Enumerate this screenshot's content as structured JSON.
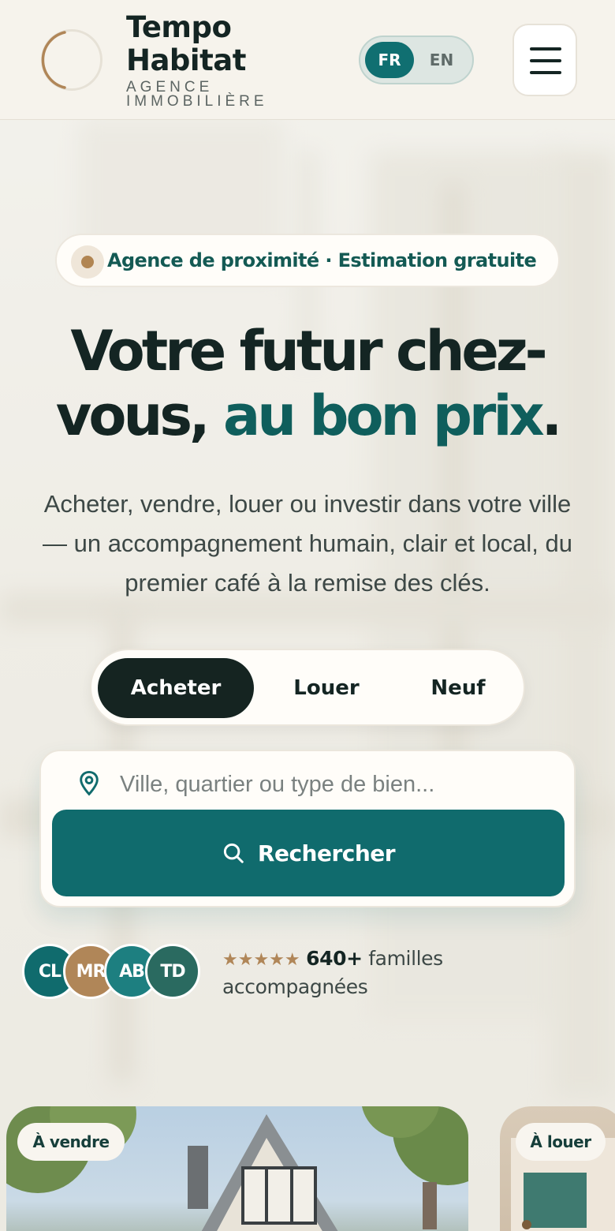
{
  "brand": {
    "title": "Tempo Habitat",
    "subtitle": "AGENCE IMMOBILIÈRE"
  },
  "lang": {
    "fr": "FR",
    "en": "EN",
    "active": "FR"
  },
  "badge": {
    "text": "Agence de proximité · Estimation gratuite"
  },
  "headline": {
    "part1": "Votre futur chez-vous, ",
    "accent": "au bon prix",
    "end": "."
  },
  "subtitle": "Acheter, vendre, louer ou investir dans votre ville — un accompagnement humain, clair et local, du premier café à la remise des clés.",
  "tabs": [
    {
      "label": "Acheter",
      "active": true
    },
    {
      "label": "Louer",
      "active": false
    },
    {
      "label": "Neuf",
      "active": false
    }
  ],
  "search": {
    "placeholder": "Ville, quartier ou type de bien...",
    "button_label": "Rechercher"
  },
  "social_proof": {
    "avatars": [
      {
        "initials": "CL",
        "color": "#106b6d"
      },
      {
        "initials": "MR",
        "color": "#b08658"
      },
      {
        "initials": "AB",
        "color": "#1d7f80"
      },
      {
        "initials": "TD",
        "color": "#2a6a60"
      }
    ],
    "stars": "★★★★★",
    "count": "640+",
    "text": "familles accompagnées"
  },
  "listings": [
    {
      "tag": "À vendre"
    },
    {
      "tag": "À louer"
    }
  ],
  "colors": {
    "accent": "#106b6d",
    "dark": "#152421",
    "gold": "#b08658"
  }
}
